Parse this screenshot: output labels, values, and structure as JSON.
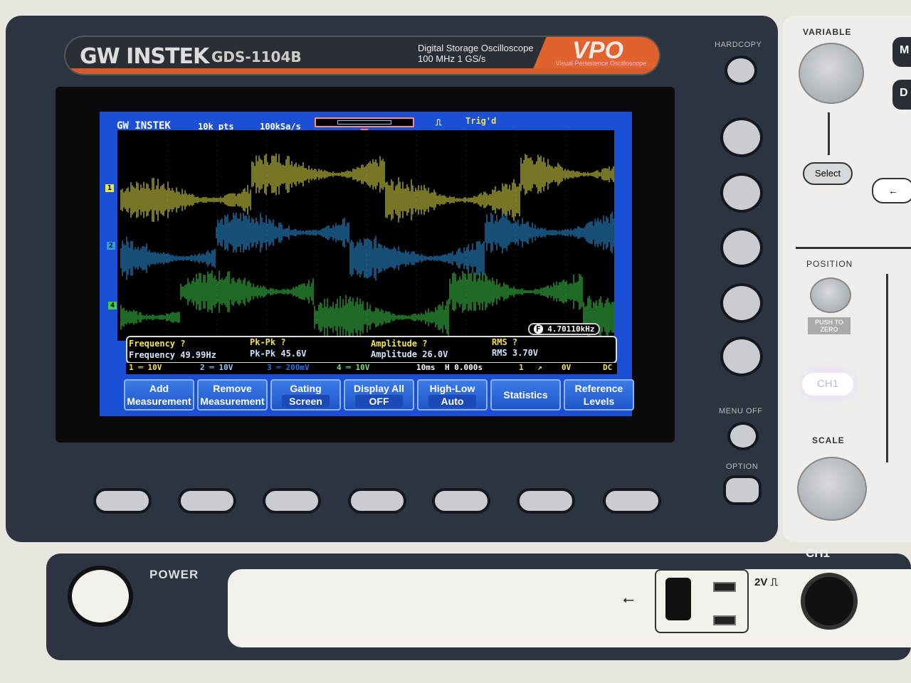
{
  "banner": {
    "brand": "GW INSTEK",
    "model": "GDS-1104B",
    "desc1": "Digital Storage Oscilloscope",
    "desc2": "100 MHz   1 GS/s",
    "vpo": "VPO",
    "vpo_sub": "Visual Persistence Oscilloscope"
  },
  "screen": {
    "logo": "GW INSTEK",
    "points": "10k pts",
    "sample_rate": "100kSa/s",
    "trigger_status": "Trig'd",
    "trigger_freq": "4.70110kHz",
    "channel_markers": [
      "1",
      "2",
      "4"
    ],
    "trace_colors": {
      "ch1": "#e8e84a",
      "ch2": "#2e9be8",
      "ch4": "#3ed04a"
    },
    "measurements": [
      {
        "ch": "1",
        "label": "Frequency ?"
      },
      {
        "ch": "2",
        "label": "Frequency 49.99Hz"
      },
      {
        "ch": "1",
        "label": "Pk-Pk ?"
      },
      {
        "ch": "2",
        "label": "Pk-Pk 45.6V"
      },
      {
        "ch": "1",
        "label": "Amplitude ?"
      },
      {
        "ch": "2",
        "label": "Amplitude 26.0V"
      },
      {
        "ch": "1",
        "label": "RMS ?"
      },
      {
        "ch": "2",
        "label": "RMS 3.70V"
      }
    ],
    "status": {
      "ch1": "1 ═ 10V",
      "ch2": "2 ═ 10V",
      "ch3": "3 ═ 200mV",
      "ch4": "4 ═ 10V",
      "timebase": "10ms",
      "hpos": "H 0.000s",
      "trig_src": "1",
      "trig_slope": "↗",
      "trig_level": "0V",
      "trig_coupling": "DC"
    },
    "softkeys": [
      {
        "l1": "Add",
        "l2": "Measurement"
      },
      {
        "l1": "Remove",
        "l2": "Measurement"
      },
      {
        "l1": "Gating",
        "l2": "Screen"
      },
      {
        "l1": "Display All",
        "l2": "OFF"
      },
      {
        "l1": "High-Low",
        "l2": "Auto"
      },
      {
        "l1": "Statistics",
        "l2": ""
      },
      {
        "l1": "Reference",
        "l2": "Levels"
      }
    ]
  },
  "panel": {
    "hardcopy": "HARDCOPY",
    "menu_off": "MENU OFF",
    "option": "OPTION",
    "variable": "VARIABLE",
    "select": "Select",
    "back": "←",
    "position": "POSITION",
    "push_to_zero": "PUSH TO ZERO",
    "ch1_button": "CH1",
    "scale": "SCALE",
    "m_btn": "M",
    "d_btn": "D",
    "ch1_input": "CH1",
    "power": "POWER",
    "probe_comp": "2V ⎍",
    "usb": "⭠"
  }
}
